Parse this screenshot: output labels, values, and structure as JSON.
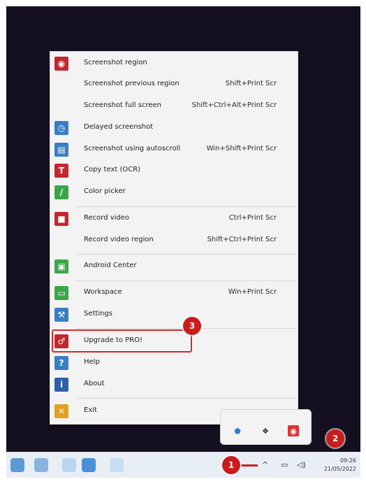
{
  "menu": {
    "items": [
      {
        "label": "Screenshot region",
        "shortcut": "",
        "icon": "camera-icon",
        "color": "#c4272f"
      },
      {
        "label": "Screenshot previous region",
        "shortcut": "Shift+Print Scr",
        "icon": "",
        "color": ""
      },
      {
        "label": "Screenshot full screen",
        "shortcut": "Shift+Ctrl+Alt+Print Scr",
        "icon": "",
        "color": ""
      },
      {
        "label": "Delayed screenshot",
        "shortcut": "",
        "icon": "timer-icon",
        "color": "#3a7fc4"
      },
      {
        "label": "Screenshot using autoscroll",
        "shortcut": "Win+Shift+Print Scr",
        "icon": "scroll-icon",
        "color": "#3a7fc4"
      },
      {
        "label": "Copy text (OCR)",
        "shortcut": "",
        "icon": "text-icon",
        "color": "#c4272f"
      },
      {
        "label": "Color picker",
        "shortcut": "",
        "icon": "color-picker-icon",
        "color": "#3aa64a"
      },
      {
        "label": "Record video",
        "shortcut": "Ctrl+Print Scr",
        "icon": "video-camera-icon",
        "color": "#c4272f"
      },
      {
        "label": "Record video region",
        "shortcut": "Shift+Ctrl+Print Scr",
        "icon": "",
        "color": ""
      },
      {
        "label": "Android Center",
        "shortcut": "",
        "icon": "android-icon",
        "color": "#3aa64a"
      },
      {
        "label": "Workspace",
        "shortcut": "Win+Print Scr",
        "icon": "workspace-icon",
        "color": "#3aa64a"
      },
      {
        "label": "Settings",
        "shortcut": "",
        "icon": "wrench-icon",
        "color": "#3a7fc4"
      },
      {
        "label": "Upgrade to PRO!",
        "shortcut": "",
        "icon": "key-icon",
        "color": "#c4272f"
      },
      {
        "label": "Help",
        "shortcut": "",
        "icon": "help-icon",
        "color": "#3a7fc4"
      },
      {
        "label": "About",
        "shortcut": "",
        "icon": "info-icon",
        "color": "#2f5fa8"
      },
      {
        "label": "Exit",
        "shortcut": "",
        "icon": "exit-icon",
        "color": "#e0a020"
      }
    ]
  },
  "icons": {
    "camera-icon": "◉",
    "timer-icon": "◷",
    "scroll-icon": "▤",
    "text-icon": "T",
    "color-picker-icon": "/",
    "video-camera-icon": "■",
    "android-icon": "▣",
    "workspace-icon": "▭",
    "wrench-icon": "⚒",
    "key-icon": "♂",
    "help-icon": "?",
    "info-icon": "i",
    "exit-icon": "✕"
  },
  "badges": {
    "one": "1",
    "two": "2",
    "three": "3"
  },
  "accent": "#c91d1d",
  "taskbar": {
    "time": "09:26",
    "date": "21/05/2022"
  }
}
